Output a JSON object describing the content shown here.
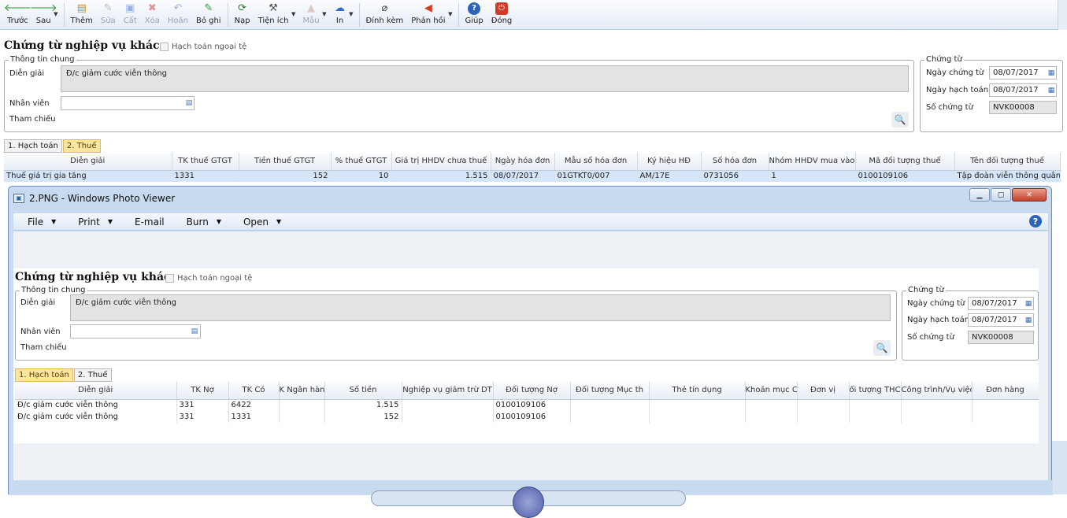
{
  "toolbar": {
    "items": [
      {
        "label": "Trước",
        "icon": "arrow-left-icon",
        "enabled": true,
        "dropdown": false
      },
      {
        "label": "Sau",
        "icon": "arrow-right-icon",
        "enabled": true,
        "dropdown": true
      },
      {
        "label": "Thêm",
        "icon": "add-icon",
        "enabled": true,
        "dropdown": false
      },
      {
        "label": "Sửa",
        "icon": "edit-icon",
        "enabled": false,
        "dropdown": false
      },
      {
        "label": "Cất",
        "icon": "save-icon",
        "enabled": false,
        "dropdown": false
      },
      {
        "label": "Xóa",
        "icon": "delete-icon",
        "enabled": false,
        "dropdown": false
      },
      {
        "label": "Hoãn",
        "icon": "undo-icon",
        "enabled": false,
        "dropdown": false
      },
      {
        "label": "Bỏ ghi",
        "icon": "unpost-icon",
        "enabled": true,
        "dropdown": false
      },
      {
        "label": "Nạp",
        "icon": "refresh-icon",
        "enabled": true,
        "dropdown": false
      },
      {
        "label": "Tiện ích",
        "icon": "tools-icon",
        "enabled": true,
        "dropdown": true
      },
      {
        "label": "Mẫu",
        "icon": "template-icon",
        "enabled": false,
        "dropdown": true
      },
      {
        "label": "In",
        "icon": "print-icon",
        "enabled": true,
        "dropdown": true
      },
      {
        "label": "Đính kèm",
        "icon": "paperclip-icon",
        "enabled": true,
        "dropdown": false
      },
      {
        "label": "Phản hồi",
        "icon": "megaphone-icon",
        "enabled": true,
        "dropdown": true
      },
      {
        "label": "Giúp",
        "icon": "help-icon",
        "enabled": true,
        "dropdown": false
      },
      {
        "label": "Đóng",
        "icon": "close-icon",
        "enabled": true,
        "dropdown": false
      }
    ]
  },
  "form": {
    "title": "Chứng từ nghiệp vụ khác",
    "foreign_currency_label": "Hạch toán ngoại tệ",
    "general_group": "Thông tin chung",
    "description_label": "Diễn giải",
    "description_value": "Đ/c giảm cước viễn thông",
    "employee_label": "Nhân viên",
    "employee_value": "",
    "reference_label": "Tham chiếu",
    "voucher_group": "Chứng từ",
    "voucher_date_label": "Ngày chứng từ",
    "voucher_date_value": "08/07/2017",
    "posting_date_label": "Ngày hạch toán",
    "posting_date_value": "08/07/2017",
    "voucher_no_label": "Số chứng từ",
    "voucher_no_value": "NVK00008",
    "tabs": [
      "1. Hạch toán",
      "2. Thuế"
    ],
    "active_tab": 1
  },
  "tax_grid": {
    "columns": [
      "Diễn giải",
      "TK thuế GTGT",
      "Tiền thuế GTGT",
      "% thuế GTGT",
      "Giá trị HHDV chưa thuế",
      "Ngày hóa đơn",
      "Mẫu số hóa đơn",
      "Ký hiệu HĐ",
      "Số hóa đơn",
      "Nhóm HHDV mua vào",
      "Mã đối tượng thuế",
      "Tên đối tượng thuế"
    ],
    "rows": [
      [
        "Thuế giá trị gia tăng",
        "1331",
        "152",
        "10",
        "1.515",
        "08/07/2017",
        "01GTKT0/007",
        "AM/17E",
        "0731056",
        "1",
        "0100109106",
        "Tập đoàn viễn thông quân đ"
      ]
    ]
  },
  "photo_viewer": {
    "title": "2.PNG - Windows Photo Viewer",
    "menu": [
      {
        "label": "File",
        "dropdown": true
      },
      {
        "label": "Print",
        "dropdown": true
      },
      {
        "label": "E-mail",
        "dropdown": false
      },
      {
        "label": "Burn",
        "dropdown": true
      },
      {
        "label": "Open",
        "dropdown": true
      }
    ],
    "inner_form": {
      "title": "Chứng từ nghiệp vụ khác",
      "foreign_currency_label": "Hạch toán ngoại tệ",
      "general_group": "Thông tin chung",
      "description_label": "Diễn giải",
      "description_value": "Đ/c giảm cước viễn thông",
      "employee_label": "Nhân viên",
      "reference_label": "Tham chiếu",
      "voucher_group": "Chứng từ",
      "voucher_date_label": "Ngày chứng từ",
      "voucher_date_value": "08/07/2017",
      "posting_date_label": "Ngày hạch toán",
      "posting_date_value": "08/07/2017",
      "voucher_no_label": "Số chứng từ",
      "voucher_no_value": "NVK00008",
      "tabs": [
        "1. Hạch toán",
        "2. Thuế"
      ],
      "active_tab": 0
    },
    "entry_grid": {
      "columns": [
        "Diễn giải",
        "TK Nợ",
        "TK Có",
        "K Ngân hàn",
        "Số tiền",
        "Nghiệp vụ giảm trừ DT",
        "Đối tượng Nợ",
        "Đối tượng Mục th",
        "Thẻ tín dụng",
        "Khoản mục CI",
        "Đơn vị",
        "ối tượng THC",
        "Công trình/Vụ việc",
        "Đơn hàng"
      ],
      "rows": [
        [
          "Đ/c giảm cước viễn thông",
          "331",
          "6422",
          "",
          "1.515",
          "",
          "0100109106",
          "",
          "",
          "",
          "",
          "",
          "",
          ""
        ],
        [
          "Đ/c giảm cước viễn thông",
          "331",
          "1331",
          "",
          "152",
          "",
          "0100109106",
          "",
          "",
          "",
          "",
          "",
          "",
          ""
        ]
      ]
    }
  }
}
